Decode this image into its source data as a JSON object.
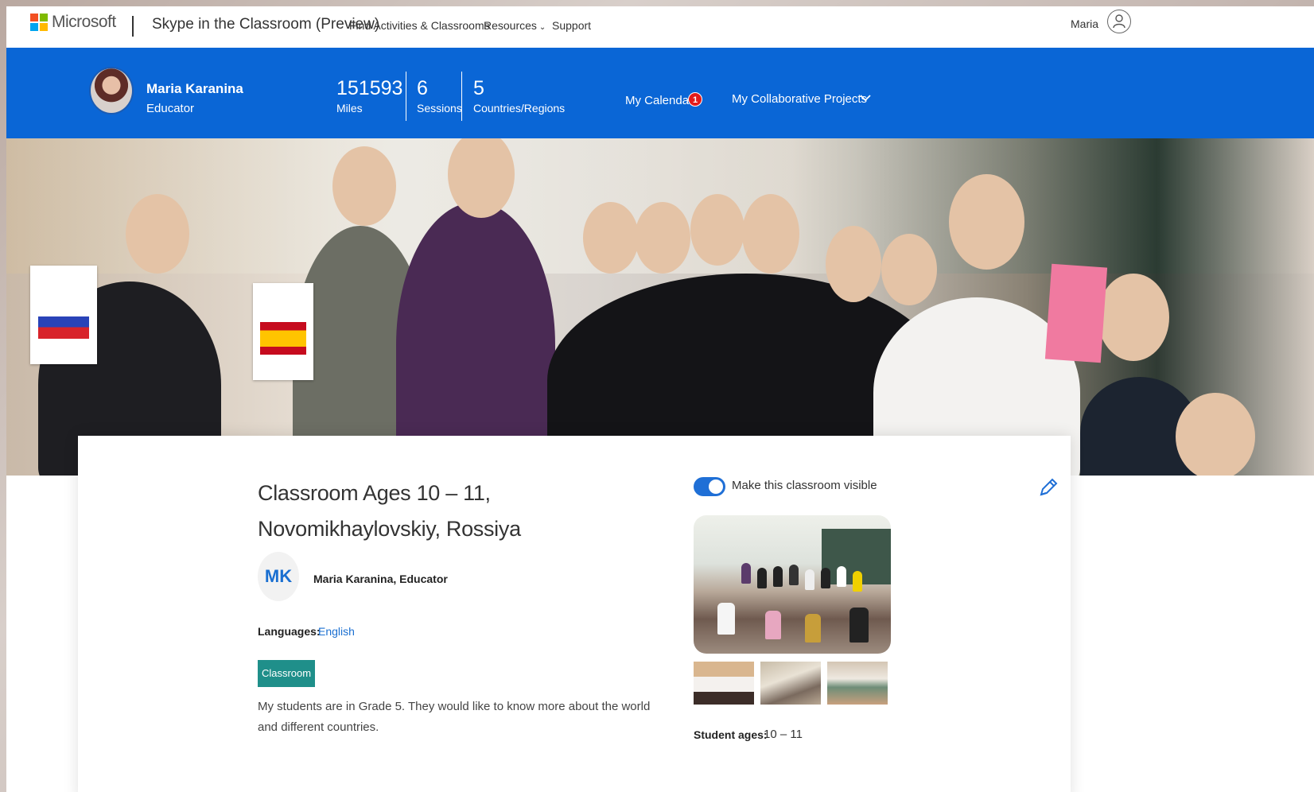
{
  "topnav": {
    "brand": "Microsoft",
    "product_title": "Skype in the Classroom (Preview)",
    "links": [
      {
        "label": "Find Activities & Classrooms"
      },
      {
        "label": "Resources"
      },
      {
        "label": "Support"
      }
    ],
    "user_name": "Maria"
  },
  "profile": {
    "name": "Maria Karanina",
    "role": "Educator"
  },
  "stats": [
    {
      "value": "151593",
      "label": "Miles"
    },
    {
      "value": "6",
      "label": "Sessions"
    },
    {
      "value": "5",
      "label": "Countries/Regions"
    }
  ],
  "calendar": {
    "label": "My Calendar",
    "badge": "1"
  },
  "projects": {
    "label": "My Collaborative Projects"
  },
  "classroom": {
    "title": "Classroom Ages 10 – 11, Novomikhaylovskiy, Rossiya",
    "owner_initials": "MK",
    "owner_name": "Maria Karanina, Educator",
    "languages_label": "Languages:",
    "languages_value": "English",
    "tag": "Classroom",
    "description": "My students are in Grade 5. They would like to know more about the world and different countries.",
    "visible_label": "Make this classroom visible",
    "visible": true,
    "ages_label": "Student ages:",
    "ages_value": "10 – 11"
  },
  "colors": {
    "accent_blue": "#0a66d6",
    "badge_red": "#e31b1b",
    "tag_teal": "#1f8f8a",
    "link_blue": "#1a6fd1"
  },
  "icons": [
    "microsoft-logo-icon",
    "chevron-down-icon",
    "user-icon",
    "pencil-icon"
  ]
}
